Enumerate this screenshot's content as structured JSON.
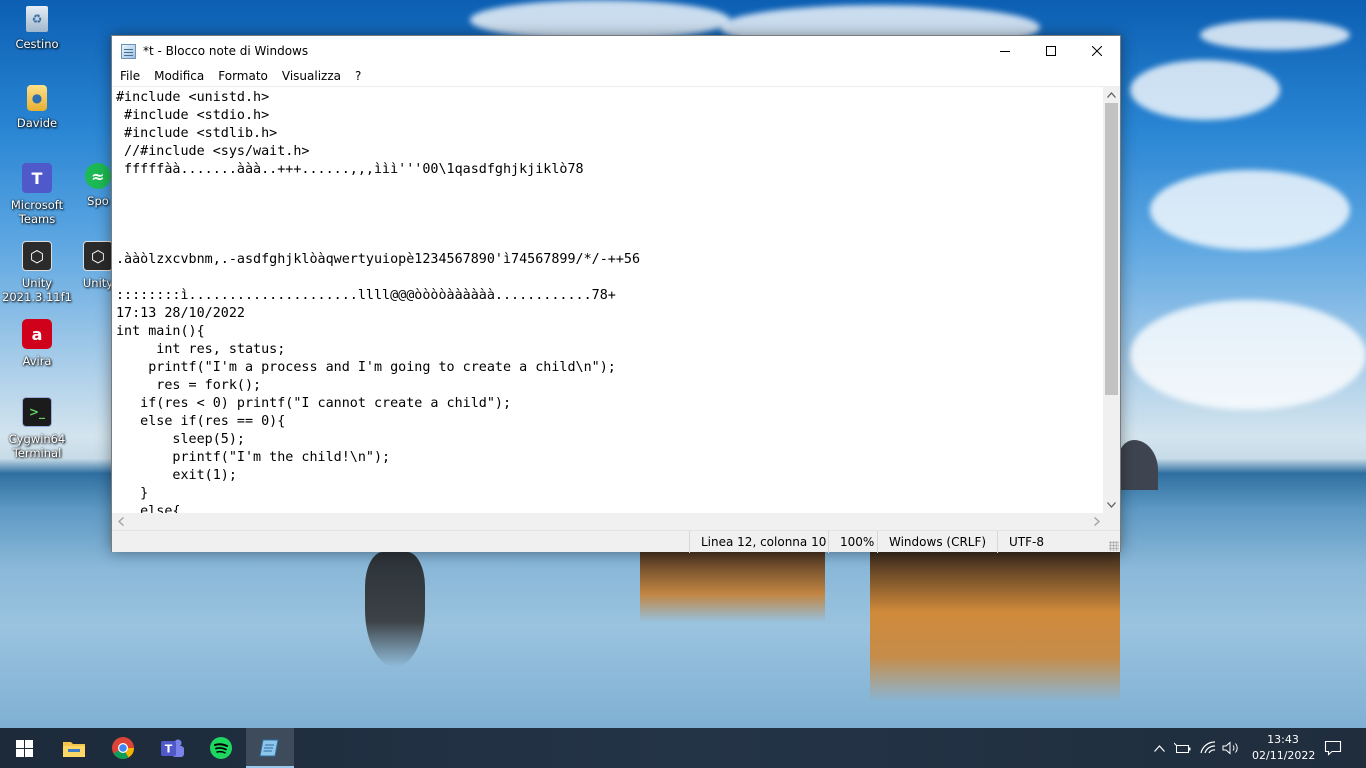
{
  "desktop": {
    "icons": [
      {
        "label": "Cestino",
        "icon": "recycle-bin-icon"
      },
      {
        "label": "Davide",
        "icon": "user-folder-icon"
      },
      {
        "label": "Microsoft Teams",
        "icon": "teams-icon"
      },
      {
        "label": "Spo",
        "icon": "spotify-icon"
      },
      {
        "label": "Unity 2021.3.11f1",
        "icon": "unity-icon"
      },
      {
        "label": "Unity",
        "icon": "unity-icon"
      },
      {
        "label": "Avira",
        "icon": "avira-icon"
      },
      {
        "label": "Cygwin64 Terminal",
        "icon": "cygwin-terminal-icon"
      }
    ]
  },
  "window": {
    "title": "*t - Blocco note di Windows",
    "menu": [
      "File",
      "Modifica",
      "Formato",
      "Visualizza",
      "?"
    ],
    "content_lines": [
      "#include <unistd.h>",
      " #include <stdio.h>",
      " #include <stdlib.h>",
      " //#include <sys/wait.h>",
      " fffffàà.......ààà..+++......,,,ììì'''00\\1qasdfghjkjiklò78",
      "",
      "",
      "",
      "",
      ".ààòlzxcvbnm,.-asdfghjklòàqwertyuiopè1234567890'ì74567899/*/-++56",
      "",
      "::::::::ì.....................llll@@@òòòòàààààà............78+",
      "17:13 28/10/2022",
      "int main(){",
      "     int res, status;",
      "    printf(\"I'm a process and I'm going to create a child\\n\");",
      "     res = fork();",
      "   if(res < 0) printf(\"I cannot create a child\");",
      "   else if(res == 0){",
      "       sleep(5);",
      "       printf(\"I'm the child!\\n\");",
      "       exit(1);",
      "   }",
      "   else{"
    ],
    "status": {
      "position": "Linea 12, colonna 10",
      "zoom": "100%",
      "line_ending": "Windows (CRLF)",
      "encoding": "UTF-8"
    }
  },
  "taskbar": {
    "apps": [
      "start-icon",
      "file-explorer-icon",
      "chrome-icon",
      "teams-icon",
      "spotify-icon",
      "notepad-icon"
    ],
    "active_app": "notepad-icon",
    "time": "13:43",
    "date": "02/11/2022"
  }
}
